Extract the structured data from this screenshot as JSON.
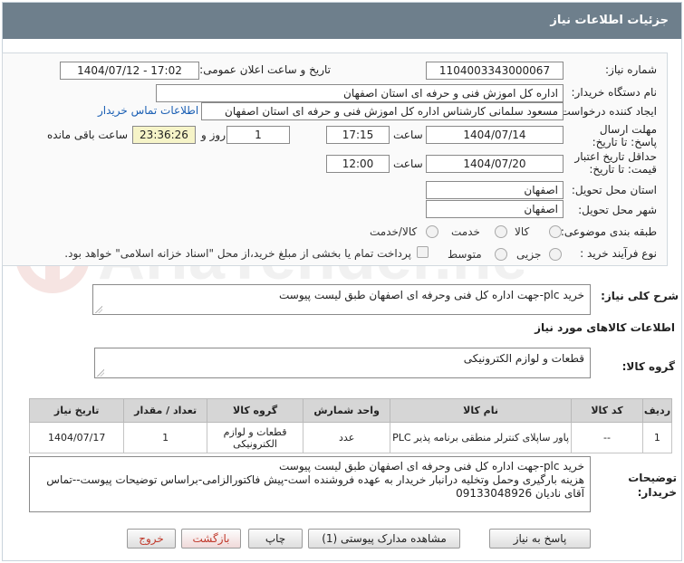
{
  "header": {
    "title": "جزئیات اطلاعات نیاز"
  },
  "form": {
    "need_number": {
      "label": "شماره نیاز:",
      "value": "1104003343000067"
    },
    "announce": {
      "label": "تاریخ و ساعت اعلان عمومی:",
      "value": "1404/07/12 - 17:02"
    },
    "buyer_org": {
      "label": "نام دستگاه خریدار:",
      "value": "اداره کل اموزش فنی و حرفه ای استان اصفهان"
    },
    "requester": {
      "label": "ایجاد کننده درخواست:",
      "value": "مسعود سلمانی کارشناس اداره کل اموزش فنی و حرفه ای استان اصفهان",
      "link": "اطلاعات تماس خریدار"
    },
    "deadline": {
      "label": "مهلت ارسال پاسخ: تا تاریخ:",
      "date": "1404/07/14",
      "time_label": "ساعت",
      "time": "17:15",
      "days": "1",
      "days_label": "روز و",
      "remaining": "23:36:26",
      "remaining_label": "ساعت باقی مانده"
    },
    "validity": {
      "label": "حداقل تاریخ اعتبار قیمت: تا تاریخ:",
      "date": "1404/07/20",
      "time_label": "ساعت",
      "time": "12:00"
    },
    "province": {
      "label": "استان محل تحویل:",
      "value": "اصفهان"
    },
    "city": {
      "label": "شهر محل تحویل:",
      "value": "اصفهان"
    },
    "category": {
      "label": "طبقه بندی موضوعی:",
      "options": [
        "کالا",
        "خدمت",
        "کالا/خدمت"
      ]
    },
    "process": {
      "label": "نوع فرآیند خرید :",
      "options": [
        "جزیی",
        "متوسط"
      ],
      "checkbox_text": "پرداخت تمام یا بخشی از مبلغ خرید،از محل \"اسناد خزانه اسلامی\" خواهد بود."
    }
  },
  "summary": {
    "label": "شرح کلی نیاز:",
    "value": "خرید plc-جهت اداره کل فنی وحرفه ای اصفهان طبق لیست پیوست"
  },
  "goods_info": {
    "title": "اطلاعات کالاهای مورد نیاز"
  },
  "goods_group": {
    "label": "گروه کالا:",
    "value": "قطعات و لوازم الکترونیکی"
  },
  "table": {
    "headers": [
      "ردیف",
      "کد کالا",
      "نام کالا",
      "واحد شمارش",
      "گروه کالا",
      "تعداد / مقدار",
      "تاریخ نیاز"
    ],
    "rows": [
      [
        "1",
        "--",
        "پاور ساپلای کنترلر منطقی برنامه پذیر PLC",
        "عدد",
        "قطعات و لوازم الکترونیکی",
        "1",
        "1404/07/17"
      ]
    ]
  },
  "notes": {
    "label": "توضیحات خریدار:",
    "lines": [
      "خرید plc-جهت اداره کل فنی وحرفه ای اصفهان طبق لیست پیوست",
      "هزینه بارگیری وحمل وتخلیه درانبار خریدار به عهده فروشنده است-پیش فاکتورالزامی-براساس توضیحات پیوست--تماس",
      "آقای نادیان 09133048926"
    ]
  },
  "buttons": {
    "reply": "پاسخ به نیاز",
    "attachments": "مشاهده مدارک پیوستی (1)",
    "print": "چاپ",
    "back": "بازگشت",
    "exit": "خروج"
  },
  "watermark": {
    "text": "AriaTender.neT"
  },
  "colors": {
    "header_bg": "#6e7f8c",
    "link": "#1a5fb4",
    "highlight": "#f6f4c8",
    "exit_text": "#c0392b"
  }
}
